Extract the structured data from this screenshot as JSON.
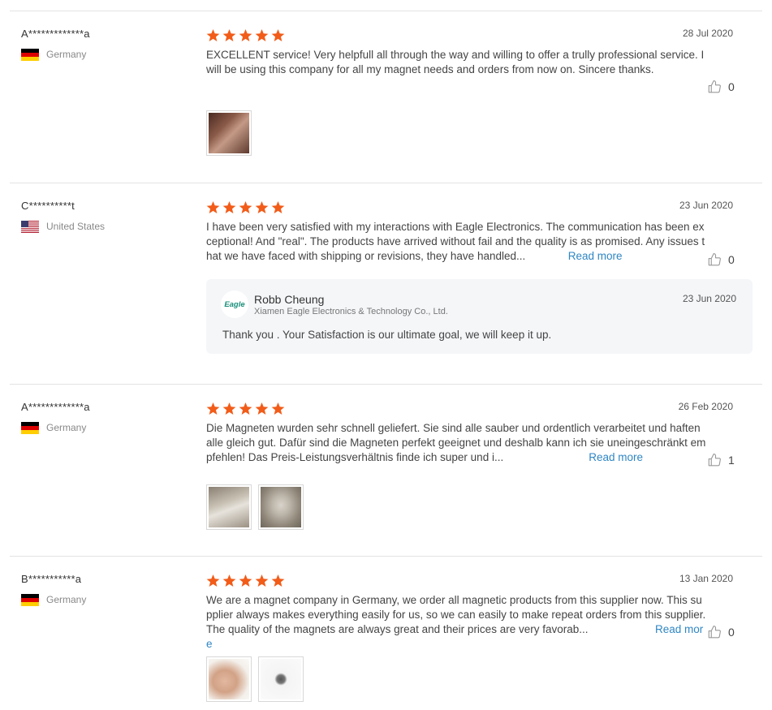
{
  "reviews": [
    {
      "user": "A*************a",
      "country": "Germany",
      "flag": "germany",
      "date": "28 Jul 2020",
      "rating": 5,
      "text": "EXCELLENT service! Very helpfull all through the way and willing to offer a trully professional service. I will be using this company for all my magnet needs and orders from now on. Sincere thanks.",
      "read_more": "",
      "likes": "0",
      "photos": [
        "Review photo"
      ]
    },
    {
      "user": "C**********t",
      "country": "United States",
      "flag": "usa",
      "date": "23 Jun 2020",
      "rating": 5,
      "text": "I have been very satisfied with my interactions with Eagle Electronics. The communication has been exceptional! And \"real\". The products have arrived without fail and the quality is as promised. Any issues that we have faced with shipping or revisions, they have handled...",
      "read_more": "Read more",
      "likes": "0",
      "reply": {
        "logo_text": "Eagle",
        "name": "Robb Cheung",
        "company": "Xiamen Eagle Electronics & Technology Co., Ltd.",
        "date": "23 Jun 2020",
        "text": "Thank you . Your Satisfaction is our ultimate goal, we will keep it up."
      }
    },
    {
      "user": "A*************a",
      "country": "Germany",
      "flag": "germany",
      "date": "26 Feb 2020",
      "rating": 5,
      "text": "Die Magneten wurden sehr schnell geliefert.  Sie sind alle sauber und ordentlich verarbeitet und haften alle gleich gut. Dafür sind die Magneten perfekt geeignet und deshalb kann ich sie uneingeschränkt empfehlen! Das Preis-Leistungsverhältnis finde ich super und i...",
      "read_more": "Read more",
      "likes": "1",
      "photos": [
        "Review photo",
        "Review photo"
      ]
    },
    {
      "user": "B***********a",
      "country": "Germany",
      "flag": "germany",
      "date": "13 Jan 2020",
      "rating": 5,
      "text": "We are a magnet company in Germany, we order all magnetic products from this supplier now. This supplier always makes everything easily for us, so we can easily to make repeat orders from this supplier. The quality of the magnets are always great and their prices are very favorab...",
      "read_more": "Read more",
      "likes": "0",
      "photos": [
        "Review photo",
        "Review photo"
      ]
    }
  ],
  "colors": {
    "star": "#f25c19",
    "link": "#2f86c4",
    "reply_bg": "#f4f6f8"
  },
  "icons": {
    "rating": "star-icon",
    "like": "thumbs-up-icon"
  }
}
